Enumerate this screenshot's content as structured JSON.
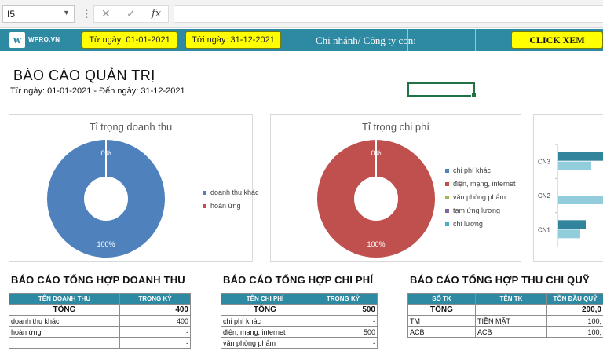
{
  "formula_bar": {
    "cell_ref": "I5",
    "fx": "fx"
  },
  "header": {
    "logo_letter": "w",
    "logo_text": "WPRO.VN",
    "from_date": "Từ ngày: 01-01-2021",
    "to_date": "Tới ngày: 31-12-2021",
    "branch_label": "Chi nhánh/ Công ty con:",
    "click_button": "CLICK XEM"
  },
  "report": {
    "title": "BÁO CÁO QUẢN TRỊ",
    "subtitle": "Từ ngày: 01-01-2021 - Đến ngày: 31-12-2021"
  },
  "colors": {
    "header": "#2e8aa2",
    "revenue_pie": "#4f81bd",
    "expense_pie": "#c0504d",
    "highlight": "#ffff00"
  },
  "chart_data": [
    {
      "type": "pie",
      "title": "Tỉ trọng doanh thu",
      "categories": [
        "doanh thu khác",
        "hoàn ứng"
      ],
      "values": [
        100,
        0
      ],
      "labels": [
        "100%",
        "0%"
      ],
      "colors": [
        "#4f81bd",
        "#c0504d"
      ],
      "legend": "right"
    },
    {
      "type": "pie",
      "title": "Tỉ trọng chi phí",
      "categories": [
        "chi phí khác",
        "điện, mạng, internet",
        "văn phòng phẩm",
        "tạm ứng lương",
        "chi lương"
      ],
      "values": [
        0,
        100,
        0,
        0,
        0
      ],
      "labels": [
        "100%",
        "0%"
      ],
      "colors": [
        "#4f81bd",
        "#c0504d",
        "#9bbb59",
        "#8064a2",
        "#4bacc6"
      ],
      "legend": "right"
    },
    {
      "type": "bar",
      "categories": [
        "CN3",
        "CN2",
        "CN1"
      ],
      "series": [
        {
          "values": [
            90,
            0,
            50
          ]
        },
        {
          "values": [
            60,
            100,
            40
          ]
        }
      ],
      "colors": [
        "#31849b",
        "#92cddc"
      ],
      "orientation": "horizontal"
    }
  ],
  "revenue_summary": {
    "title": "BÁO CÁO TỔNG HỢP DOANH THU",
    "headers": [
      "TÊN DOANH THU",
      "TRONG KỲ"
    ],
    "total": [
      "TỔNG",
      "400"
    ],
    "rows": [
      [
        "doanh thu khác",
        "400"
      ],
      [
        "hoàn ứng",
        "-"
      ],
      [
        "",
        "-"
      ]
    ]
  },
  "expense_summary": {
    "title": "BÁO CÁO TỔNG HỢP CHI PHÍ",
    "headers": [
      "TÊN CHI PHÍ",
      "TRONG KỲ"
    ],
    "total": [
      "TỔNG",
      "500"
    ],
    "rows": [
      [
        "chi phí khác",
        "-"
      ],
      [
        "điện, mạng, internet",
        "500"
      ],
      [
        "văn phòng phẩm",
        "-"
      ]
    ]
  },
  "fund_summary": {
    "title": "BÁO CÁO TỔNG HỢP THU CHI QUỸ",
    "headers": [
      "SỐ TK",
      "TÊN TK",
      "TỒN ĐẦU QUỸ"
    ],
    "total": [
      "TỔNG",
      "",
      "200,0"
    ],
    "rows": [
      [
        "TM",
        "TIỀN MẶT",
        "100,"
      ],
      [
        "ACB",
        "ACB",
        "100,"
      ]
    ]
  }
}
